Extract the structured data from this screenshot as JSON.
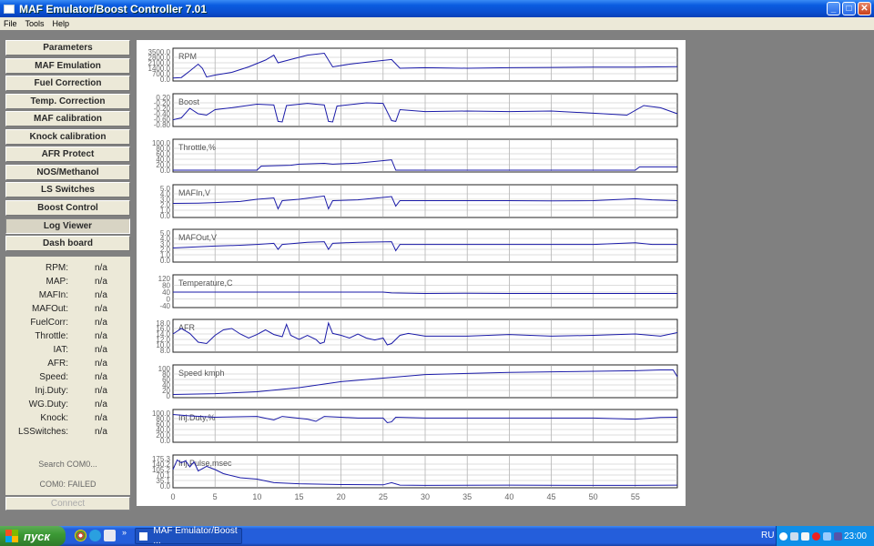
{
  "window": {
    "title": "MAF Emulator/Boost Controller 7.01",
    "minimize": "_",
    "maximize": "□",
    "close": "✕"
  },
  "menu": [
    "File",
    "Tools",
    "Help"
  ],
  "nav": [
    {
      "label": "Parameters",
      "active": false
    },
    {
      "label": "MAF Emulation",
      "active": false
    },
    {
      "label": "Fuel Correction",
      "active": false
    },
    {
      "label": "Temp. Correction",
      "active": false
    },
    {
      "label": "MAF calibration",
      "active": false
    },
    {
      "label": "Knock calibration",
      "active": false
    },
    {
      "label": "AFR Protect",
      "active": false
    },
    {
      "label": "NOS/Methanol",
      "active": false
    },
    {
      "label": "LS Switches",
      "active": false
    },
    {
      "label": "Boost Control",
      "active": false
    },
    {
      "label": "Log Viewer",
      "active": true
    },
    {
      "label": "Dash board",
      "active": false
    }
  ],
  "status": [
    {
      "label": "RPM:",
      "value": "n/a"
    },
    {
      "label": "MAP:",
      "value": "n/a"
    },
    {
      "label": "MAFIn:",
      "value": "n/a"
    },
    {
      "label": "MAFOut:",
      "value": "n/a"
    },
    {
      "label": "FuelCorr:",
      "value": "n/a"
    },
    {
      "label": "Throttle:",
      "value": "n/a"
    },
    {
      "label": "IAT:",
      "value": "n/a"
    },
    {
      "label": "AFR:",
      "value": "n/a"
    },
    {
      "label": "Speed:",
      "value": "n/a"
    },
    {
      "label": "Inj.Duty:",
      "value": "n/a"
    },
    {
      "label": "WG.Duty:",
      "value": "n/a"
    },
    {
      "label": "Knock:",
      "value": "n/a"
    },
    {
      "label": "LSSwitches:",
      "value": "n/a"
    }
  ],
  "search_text": "Search COM0...",
  "com_status": "COM0: FAILED",
  "connect_label": "Connect",
  "log_plots": [
    {
      "name": "RPM",
      "ticks": [
        "3500.0",
        "2800.0",
        "2100.0",
        "1400.0",
        "700.0",
        "0.0"
      ],
      "color": "#1a1aa8"
    },
    {
      "name": "Boost",
      "ticks": [
        "0.20",
        "-0.20",
        "-0.20",
        "-0.40",
        "-0.60",
        "-0.80"
      ],
      "color": "#1a1aa8"
    },
    {
      "name": "Throttle,%",
      "ticks": [
        "100.0",
        "80.0",
        "60.0",
        "40.0",
        "20.0",
        "0.0"
      ],
      "color": "#1a1aa8"
    },
    {
      "name": "MAFIn,V",
      "ticks": [
        "5.0",
        "4.0",
        "3.0",
        "2.0",
        "1.0",
        "0.0"
      ],
      "color": "#1a1aa8"
    },
    {
      "name": "MAFOut,V",
      "ticks": [
        "5.0",
        "4.0",
        "3.0",
        "2.0",
        "1.0",
        "0.0"
      ],
      "color": "#1a1aa8"
    },
    {
      "name": "Temperature,C",
      "ticks": [
        "120",
        "80",
        "40",
        "0",
        "-40"
      ],
      "color": "#1a1aa8"
    },
    {
      "name": "AFR",
      "ticks": [
        "18.0",
        "16.0",
        "14.0",
        "12.0",
        "10.0",
        "8.0"
      ],
      "color": "#1a1aa8"
    },
    {
      "name": "Speed kmph",
      "ticks": [
        "100",
        "80",
        "60",
        "40",
        "20",
        "0"
      ],
      "color": "#1a1aa8"
    },
    {
      "name": "Inj.Duty,%",
      "ticks": [
        "100.0",
        "80.0",
        "60.0",
        "40.0",
        "20.0",
        "0.0"
      ],
      "color": "#1a1aa8"
    },
    {
      "name": "Inj.Pulse,msec",
      "ticks": [
        "175.3",
        "140.2",
        "105.2",
        "70.1",
        "35.1",
        "0.0"
      ],
      "color": "#1a1aa8"
    }
  ],
  "x_axis": {
    "ticks": [
      "0",
      "5",
      "10",
      "15",
      "20",
      "25",
      "30",
      "35",
      "40",
      "45",
      "50",
      "55"
    ],
    "max": 60
  },
  "series": [
    [
      [
        0,
        4
      ],
      [
        1,
        6
      ],
      [
        2,
        30
      ],
      [
        3,
        55
      ],
      [
        3.5,
        40
      ],
      [
        4,
        8
      ],
      [
        5,
        15
      ],
      [
        7,
        25
      ],
      [
        9,
        45
      ],
      [
        11,
        70
      ],
      [
        12,
        88
      ],
      [
        12.5,
        60
      ],
      [
        14,
        72
      ],
      [
        16,
        88
      ],
      [
        18,
        95
      ],
      [
        19,
        45
      ],
      [
        21,
        55
      ],
      [
        23,
        62
      ],
      [
        26,
        72
      ],
      [
        27,
        40
      ],
      [
        30,
        42
      ],
      [
        35,
        40
      ],
      [
        40,
        42
      ],
      [
        45,
        43
      ],
      [
        50,
        44
      ],
      [
        55,
        44
      ],
      [
        60,
        46
      ]
    ],
    [
      [
        0,
        18
      ],
      [
        1,
        25
      ],
      [
        2,
        60
      ],
      [
        3,
        40
      ],
      [
        4,
        35
      ],
      [
        5,
        55
      ],
      [
        7,
        62
      ],
      [
        10,
        75
      ],
      [
        12,
        72
      ],
      [
        12.5,
        12
      ],
      [
        13,
        10
      ],
      [
        13.5,
        70
      ],
      [
        16,
        78
      ],
      [
        18,
        72
      ],
      [
        18.5,
        12
      ],
      [
        19,
        10
      ],
      [
        19.5,
        68
      ],
      [
        23,
        80
      ],
      [
        25,
        78
      ],
      [
        26,
        15
      ],
      [
        26.5,
        12
      ],
      [
        27,
        55
      ],
      [
        30,
        48
      ],
      [
        35,
        50
      ],
      [
        40,
        48
      ],
      [
        45,
        50
      ],
      [
        50,
        42
      ],
      [
        54,
        35
      ],
      [
        56,
        70
      ],
      [
        58,
        62
      ],
      [
        60,
        40
      ]
    ],
    [
      [
        0,
        0
      ],
      [
        10,
        0
      ],
      [
        10.5,
        15
      ],
      [
        14,
        18
      ],
      [
        15,
        22
      ],
      [
        18,
        25
      ],
      [
        19,
        22
      ],
      [
        22,
        26
      ],
      [
        26,
        38
      ],
      [
        26.5,
        0
      ],
      [
        35,
        0
      ],
      [
        45,
        0
      ],
      [
        55,
        0
      ],
      [
        55.5,
        12
      ],
      [
        60,
        12
      ]
    ],
    [
      [
        0,
        45
      ],
      [
        3,
        46
      ],
      [
        5,
        48
      ],
      [
        8,
        52
      ],
      [
        10,
        60
      ],
      [
        12,
        65
      ],
      [
        12.5,
        25
      ],
      [
        13,
        55
      ],
      [
        15,
        60
      ],
      [
        18,
        72
      ],
      [
        18.5,
        25
      ],
      [
        19,
        55
      ],
      [
        22,
        58
      ],
      [
        26,
        70
      ],
      [
        26.5,
        35
      ],
      [
        27,
        55
      ],
      [
        30,
        55
      ],
      [
        40,
        55
      ],
      [
        45,
        54
      ],
      [
        50,
        55
      ],
      [
        55,
        62
      ],
      [
        57,
        58
      ],
      [
        60,
        55
      ]
    ],
    [
      [
        0,
        45
      ],
      [
        2,
        48
      ],
      [
        5,
        52
      ],
      [
        8,
        55
      ],
      [
        10,
        58
      ],
      [
        12,
        62
      ],
      [
        12.5,
        40
      ],
      [
        13,
        58
      ],
      [
        16,
        66
      ],
      [
        18,
        68
      ],
      [
        18.5,
        40
      ],
      [
        19,
        62
      ],
      [
        22,
        66
      ],
      [
        26,
        68
      ],
      [
        26.5,
        35
      ],
      [
        27,
        58
      ],
      [
        30,
        58
      ],
      [
        40,
        58
      ],
      [
        45,
        58
      ],
      [
        50,
        58
      ],
      [
        55,
        64
      ],
      [
        57,
        58
      ],
      [
        60,
        58
      ]
    ],
    [
      [
        0,
        50
      ],
      [
        5,
        50
      ],
      [
        10,
        50
      ],
      [
        15,
        50
      ],
      [
        20,
        50
      ],
      [
        25,
        50
      ],
      [
        26,
        47
      ],
      [
        30,
        45
      ],
      [
        35,
        46
      ],
      [
        40,
        45
      ],
      [
        45,
        45
      ],
      [
        50,
        45
      ],
      [
        55,
        45
      ],
      [
        60,
        45
      ]
    ],
    [
      [
        0,
        60
      ],
      [
        1,
        80
      ],
      [
        2,
        62
      ],
      [
        3,
        30
      ],
      [
        4,
        25
      ],
      [
        5,
        55
      ],
      [
        6,
        75
      ],
      [
        7,
        80
      ],
      [
        8,
        60
      ],
      [
        9,
        45
      ],
      [
        10,
        58
      ],
      [
        11,
        75
      ],
      [
        12,
        58
      ],
      [
        13,
        50
      ],
      [
        13.5,
        95
      ],
      [
        14,
        55
      ],
      [
        15,
        40
      ],
      [
        16,
        55
      ],
      [
        17,
        40
      ],
      [
        17.5,
        25
      ],
      [
        18,
        30
      ],
      [
        18.5,
        100
      ],
      [
        19,
        62
      ],
      [
        20,
        55
      ],
      [
        21,
        45
      ],
      [
        22,
        60
      ],
      [
        23,
        45
      ],
      [
        24,
        38
      ],
      [
        25,
        45
      ],
      [
        25.5,
        20
      ],
      [
        26,
        25
      ],
      [
        27,
        55
      ],
      [
        28,
        62
      ],
      [
        30,
        52
      ],
      [
        35,
        52
      ],
      [
        40,
        58
      ],
      [
        45,
        52
      ],
      [
        50,
        55
      ],
      [
        55,
        60
      ],
      [
        58,
        52
      ],
      [
        60,
        65
      ]
    ],
    [
      [
        0,
        5
      ],
      [
        5,
        8
      ],
      [
        10,
        15
      ],
      [
        15,
        30
      ],
      [
        20,
        52
      ],
      [
        25,
        65
      ],
      [
        30,
        78
      ],
      [
        35,
        82
      ],
      [
        40,
        86
      ],
      [
        45,
        88
      ],
      [
        50,
        90
      ],
      [
        55,
        92
      ],
      [
        58,
        95
      ],
      [
        59.5,
        95
      ],
      [
        60,
        70
      ]
    ],
    [
      [
        0,
        95
      ],
      [
        2,
        90
      ],
      [
        5,
        85
      ],
      [
        10,
        88
      ],
      [
        12,
        75
      ],
      [
        13,
        88
      ],
      [
        16,
        78
      ],
      [
        17,
        70
      ],
      [
        18,
        88
      ],
      [
        22,
        82
      ],
      [
        25,
        82
      ],
      [
        25.5,
        65
      ],
      [
        26,
        68
      ],
      [
        26.5,
        85
      ],
      [
        30,
        82
      ],
      [
        40,
        82
      ],
      [
        50,
        82
      ],
      [
        55,
        78
      ],
      [
        58,
        84
      ],
      [
        60,
        85
      ]
    ],
    [
      [
        0,
        60
      ],
      [
        0.5,
        95
      ],
      [
        1,
        85
      ],
      [
        1.5,
        92
      ],
      [
        2,
        70
      ],
      [
        2.5,
        88
      ],
      [
        3,
        55
      ],
      [
        4,
        72
      ],
      [
        5,
        60
      ],
      [
        6,
        45
      ],
      [
        8,
        30
      ],
      [
        10,
        25
      ],
      [
        12,
        12
      ],
      [
        15,
        8
      ],
      [
        20,
        5
      ],
      [
        25,
        4
      ],
      [
        26,
        12
      ],
      [
        27,
        3
      ],
      [
        30,
        2
      ],
      [
        40,
        3
      ],
      [
        50,
        2
      ],
      [
        55,
        2
      ],
      [
        60,
        3
      ]
    ]
  ]
}
